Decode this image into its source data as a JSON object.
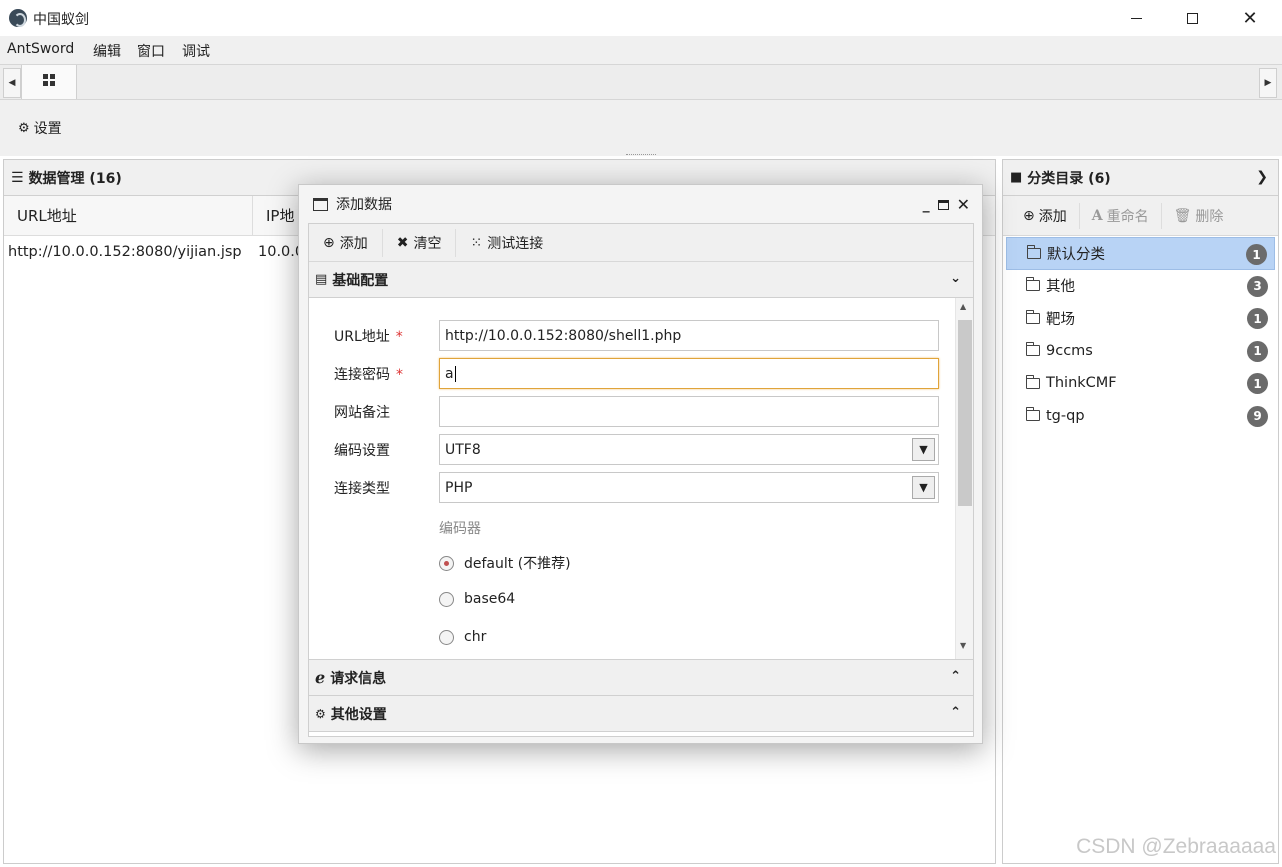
{
  "window": {
    "title": "中国蚁剑"
  },
  "menu": [
    "AntSword",
    "编辑",
    "窗口",
    "调试"
  ],
  "toolbar": {
    "settings_label": "设置"
  },
  "data_panel": {
    "title": "数据管理 (16)",
    "columns": [
      "URL地址",
      "IP地"
    ],
    "rows": [
      {
        "url": "http://10.0.0.152:8080/yijian.jsp",
        "ip": "10.0.0"
      }
    ]
  },
  "category_panel": {
    "title": "分类目录 (6)",
    "buttons": {
      "add": "添加",
      "rename": "重命名",
      "delete": "删除"
    },
    "items": [
      {
        "name": "默认分类",
        "count": "1",
        "selected": true
      },
      {
        "name": "其他",
        "count": "3"
      },
      {
        "name": "靶场",
        "count": "1"
      },
      {
        "name": "9ccms",
        "count": "1"
      },
      {
        "name": "ThinkCMF",
        "count": "1"
      },
      {
        "name": "tg-qp",
        "count": "9"
      }
    ]
  },
  "dialog": {
    "title": "添加数据",
    "toolbar": {
      "add": "添加",
      "clear": "清空",
      "test": "测试连接"
    },
    "basic_section": "基础配置",
    "fields": {
      "url_label": "URL地址",
      "url_value": "http://10.0.0.152:8080/shell1.php",
      "password_label": "连接密码",
      "password_value": "a",
      "note_label": "网站备注",
      "note_value": "",
      "encoding_label": "编码设置",
      "encoding_value": "UTF8",
      "type_label": "连接类型",
      "type_value": "PHP",
      "required_mark": "*"
    },
    "encoder": {
      "label": "编码器",
      "options": [
        "default (不推荐)",
        "base64",
        "chr"
      ],
      "selected": "default (不推荐)"
    },
    "request_section": "请求信息",
    "other_section": "其他设置"
  },
  "watermark": "CSDN @Zebraaaaaa"
}
